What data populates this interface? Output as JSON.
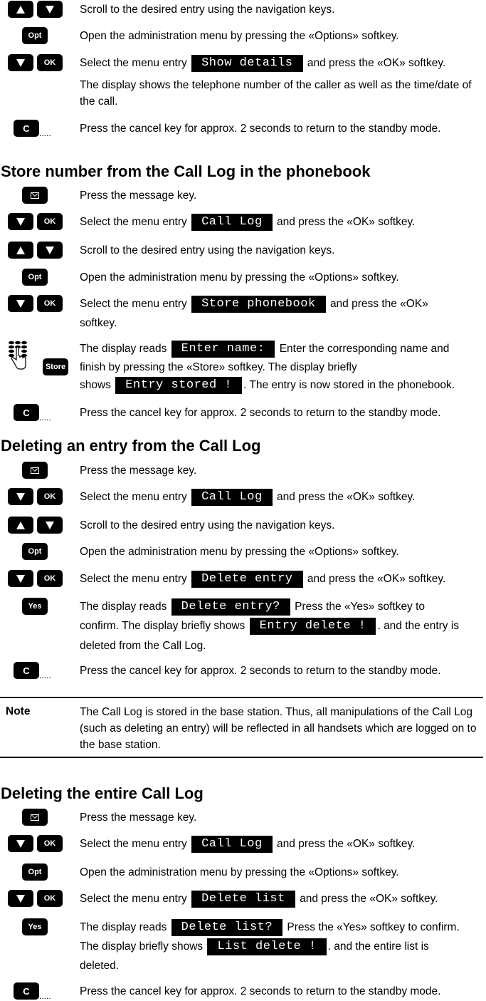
{
  "keys": {
    "opt": "Opt",
    "ok": "OK",
    "c": "C",
    "yes": "Yes",
    "store": "Store",
    "dots": "....."
  },
  "intro": {
    "scroll": "Scroll to the desired entry using the navigation keys.",
    "options": "Open the administration menu by pressing the «Options» softkey.",
    "select_pre": "Select the menu entry",
    "select_lcd": "Show details",
    "select_post": "and press the «OK» softkey.",
    "display_shows": "The display shows the telephone number of the caller as well as the time/date of the call.",
    "cancel": "Press the cancel key for approx. 2 seconds to return to the standby mode."
  },
  "section_store": {
    "title": "Store number from the Call Log in the phonebook",
    "message": "Press the message key.",
    "select1_pre": "Select the menu entry",
    "select1_lcd": "Call Log",
    "select1_post": "and press the «OK» softkey.",
    "scroll": "Scroll to the desired entry using the navigation keys.",
    "options": "Open the administration menu by pressing the «Options» softkey.",
    "select2_pre": "Select the menu entry",
    "select2_lcd": "Store phonebook",
    "select2_post": "and press the «OK»",
    "select2_post2": "softkey.",
    "reads_pre": "The display reads",
    "reads_lcd": "Enter name:",
    "reads_post": "Enter the corresponding name and",
    "reads_line2": "finish by pressing the «Store» softkey. The display briefly",
    "reads_line3_pre": "shows",
    "reads_line3_lcd": "Entry stored !",
    "reads_line3_post": ". The entry is now stored in the phonebook.",
    "cancel": "Press the cancel key for approx. 2 seconds to return to the standby mode."
  },
  "section_delete_entry": {
    "title": "Deleting an entry from the Call Log",
    "message": "Press the message key.",
    "select1_pre": "Select the menu entry",
    "select1_lcd": "Call Log",
    "select1_post": "and press the «OK» softkey.",
    "scroll": "Scroll to the desired entry using the navigation keys.",
    "options": "Open the administration menu by pressing the «Options» softkey.",
    "select2_pre": "Select the menu entry",
    "select2_lcd": "Delete entry",
    "select2_post": "and press the «OK» softkey.",
    "reads_pre": "The display reads",
    "reads_lcd": "Delete entry?",
    "reads_post": "Press the «Yes» softkey to",
    "reads_line2_pre": "confirm. The display briefly shows",
    "reads_line2_lcd": "Entry delete !",
    "reads_line2_post": ". and the entry is",
    "reads_line3": "deleted from the Call Log.",
    "cancel": "Press the cancel key for approx. 2 seconds to return to the standby mode."
  },
  "note": {
    "label": "Note",
    "text": "The Call Log is stored in the base station. Thus, all manipulations of the Call Log (such as deleting an entry) will be reflected in all handsets which are logged on to the base station."
  },
  "section_delete_all": {
    "title": "Deleting the entire Call Log",
    "message": "Press the message key.",
    "select1_pre": "Select the menu entry",
    "select1_lcd": "Call Log",
    "select1_post": "and press the «OK» softkey.",
    "options": "Open the administration menu by pressing the «Options» softkey.",
    "select2_pre": "Select the menu entry",
    "select2_lcd": "Delete list",
    "select2_post": "and press the «OK» softkey.",
    "reads_pre": "The display reads",
    "reads_lcd": "Delete list?",
    "reads_post": "Press the «Yes» softkey to confirm.",
    "reads_line2_pre": "The display briefly shows",
    "reads_line2_lcd": "List delete !",
    "reads_line2_post": ". and the entire list is",
    "reads_line3": "deleted.",
    "cancel": "Press the cancel key for approx. 2 seconds to return to the standby mode."
  }
}
